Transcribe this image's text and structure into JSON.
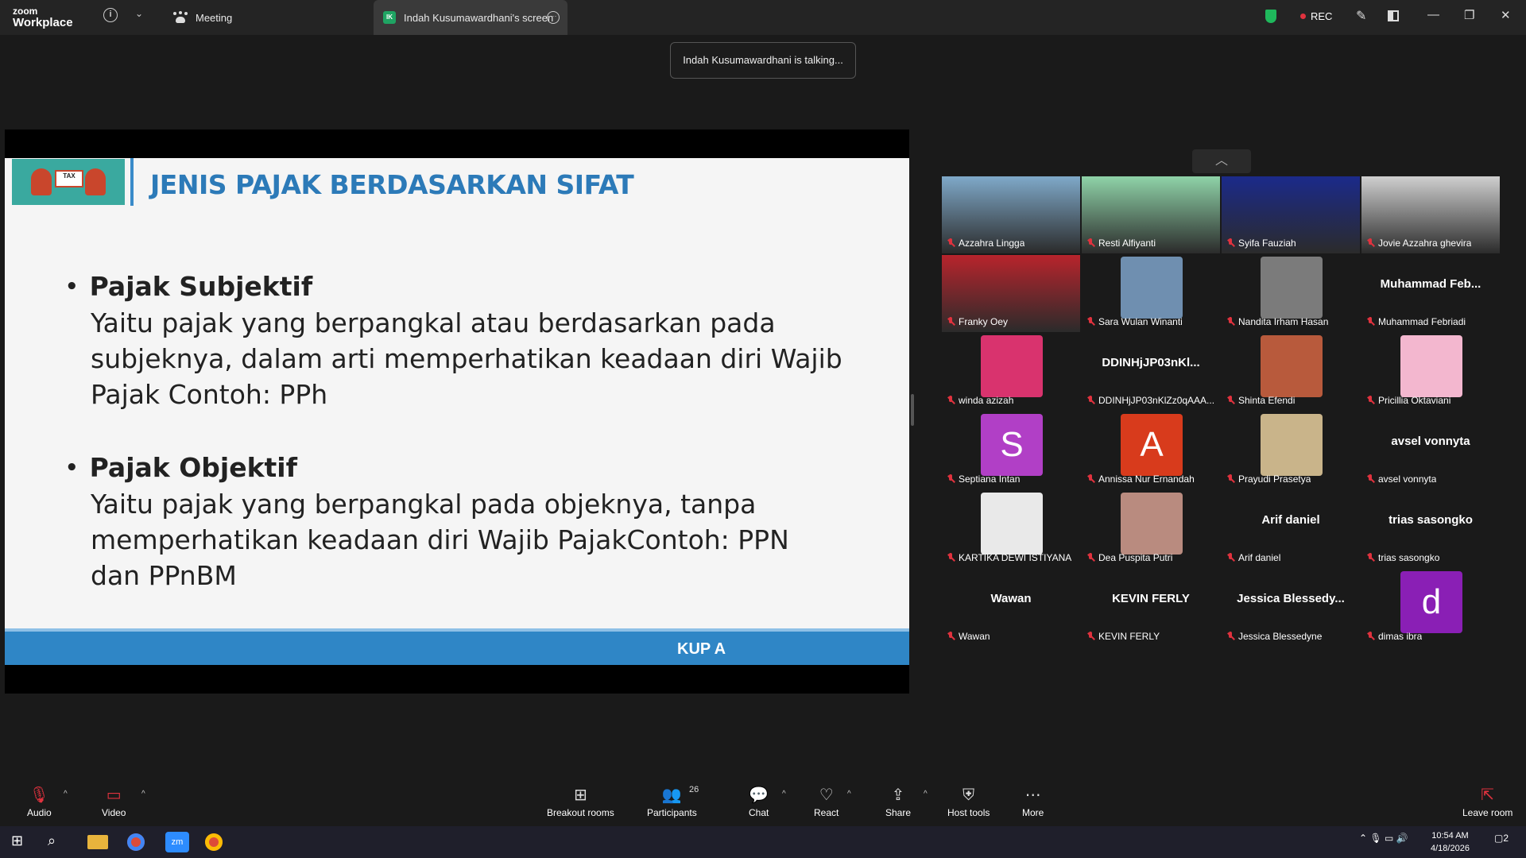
{
  "titlebar": {
    "logo_line1": "zoom",
    "logo_line2": "Workplace",
    "tab_meeting": "Meeting",
    "tab_screen_badge": "IK",
    "tab_screen": "Indah Kusumawardhani's screen",
    "rec_label": "REC"
  },
  "toast": {
    "text": "Indah Kusumawardhani is talking..."
  },
  "slide": {
    "title": "JENIS PAJAK BERDASARKAN SIFAT",
    "tax_sign": "TAX",
    "bullets": [
      {
        "heading": "Pajak Subjektif",
        "body": "Yaitu pajak yang berpangkal atau berdasarkan pada subjeknya, dalam arti memperhatikan keadaan diri Wajib Pajak Contoh: PPh"
      },
      {
        "heading": "Pajak Objektif",
        "body": "Yaitu pajak yang berpangkal pada objeknya, tanpa memperhatikan keadaan diri Wajib PajakContoh: PPN dan PPnBM"
      }
    ],
    "footer": "KUP A"
  },
  "participants": [
    {
      "name": "Azzahra Lingga",
      "kind": "video",
      "color": "#7fa9c9"
    },
    {
      "name": "Resti Alfiyanti",
      "kind": "video",
      "color": "#8fd3a8"
    },
    {
      "name": "Syifa Fauziah",
      "kind": "video",
      "color": "#1b2a8a"
    },
    {
      "name": "Jovie Azzahra ghevira",
      "kind": "video",
      "color": "#cfcfcf"
    },
    {
      "name": "Franky Oey",
      "kind": "video",
      "color": "#b8242c"
    },
    {
      "name": "Sara Wulan Winanti",
      "kind": "photo",
      "color": "#6f8fb0"
    },
    {
      "name": "Nandita Irham Hasan",
      "kind": "photo",
      "color": "#7b7b7b"
    },
    {
      "name": "Muhammad Febriadi",
      "kind": "text",
      "display": "Muhammad  Feb..."
    },
    {
      "name": "winda azizah",
      "kind": "photo",
      "color": "#d9336e"
    },
    {
      "name": "DDINHjJP03nKlZz0qAAA...",
      "kind": "text",
      "display": "DDINHjJP03nKl..."
    },
    {
      "name": "Shinta Efendi",
      "kind": "photo",
      "color": "#b85a3c"
    },
    {
      "name": "Pricillia Oktaviani",
      "kind": "photo",
      "color": "#f3b7cf"
    },
    {
      "name": "Septiana Intan",
      "kind": "avatar",
      "letter": "S",
      "color": "#b13fc6"
    },
    {
      "name": "Annissa Nur Ernandah",
      "kind": "avatar",
      "letter": "A",
      "color": "#d83b1c"
    },
    {
      "name": "Prayudi Prasetya",
      "kind": "photo",
      "color": "#c9b48a"
    },
    {
      "name": "avsel vonnyta",
      "kind": "text",
      "display": "avsel vonnyta"
    },
    {
      "name": "KARTIKA DEWI ISTIYANA",
      "kind": "photo",
      "color": "#e9e9e9"
    },
    {
      "name": "Dea Puspita Putri",
      "kind": "photo",
      "color": "#b98b7f"
    },
    {
      "name": "Arif daniel",
      "kind": "text",
      "display": "Arif daniel"
    },
    {
      "name": "trias sasongko",
      "kind": "text",
      "display": "trias sasongko"
    },
    {
      "name": "Wawan",
      "kind": "text",
      "display": "Wawan"
    },
    {
      "name": "KEVIN FERLY",
      "kind": "text",
      "display": "KEVIN FERLY"
    },
    {
      "name": "Jessica Blessedyne",
      "kind": "text",
      "display": "Jessica  Blessedy..."
    },
    {
      "name": "dimas ibra",
      "kind": "avatar",
      "letter": "d",
      "color": "#8a1fb5"
    }
  ],
  "toolbar": {
    "audio": "Audio",
    "video": "Video",
    "breakout": "Breakout rooms",
    "participants": "Participants",
    "participants_count": "26",
    "chat": "Chat",
    "react": "React",
    "share": "Share",
    "host_tools": "Host tools",
    "more": "More",
    "leave": "Leave room"
  },
  "taskbar": {
    "time": "10:54 AM",
    "date": "4/18/2026",
    "notif_count": "2"
  }
}
